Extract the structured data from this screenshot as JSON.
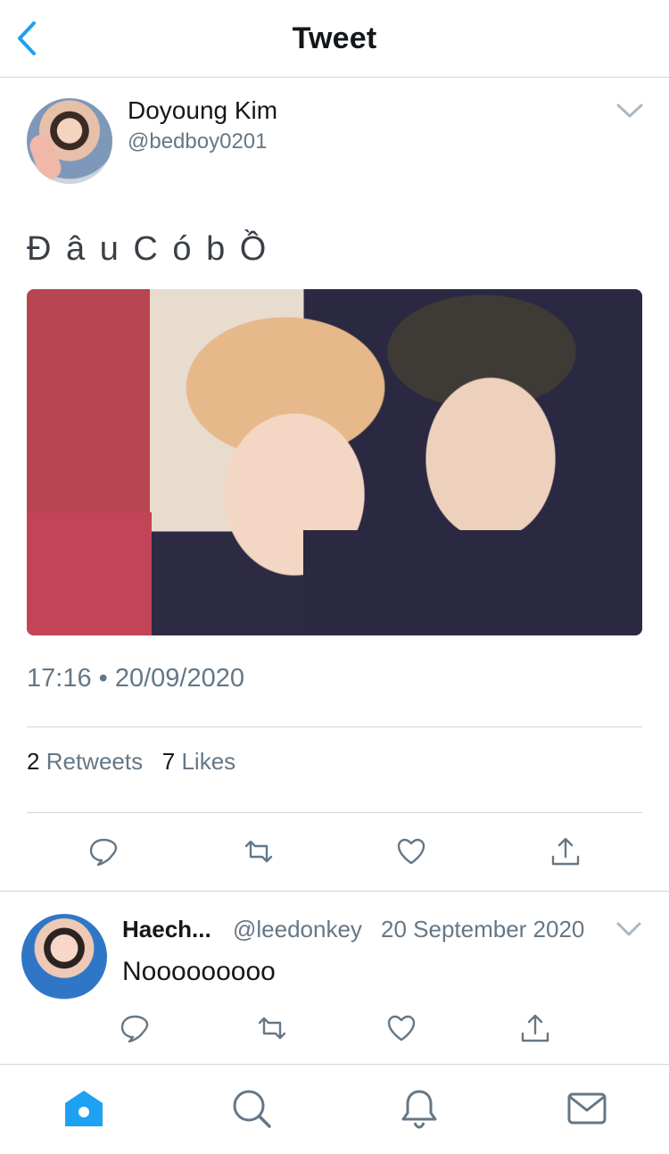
{
  "header": {
    "title": "Tweet"
  },
  "tweet": {
    "author_name": "Doyoung Kim",
    "author_handle": "@bedboy0201",
    "text": "Đ â u C ó b Ồ",
    "timestamp": "17:16 • 20/09/2020",
    "retweets_count": "2",
    "retweets_label": "Retweets",
    "likes_count": "7",
    "likes_label": "Likes"
  },
  "reply": {
    "author_name": "Haech...",
    "author_handle": "@leedonkey",
    "date": "20 September 2020",
    "text": "Nooooooooo"
  },
  "icons": {
    "back": "chevron-left-icon",
    "caret": "chevron-down-icon",
    "actions": [
      "reply-icon",
      "retweet-icon",
      "like-icon",
      "share-icon"
    ],
    "tabs": [
      "home-icon",
      "search-icon",
      "notifications-icon",
      "messages-icon"
    ]
  },
  "colors": {
    "accent": "#1da1f2",
    "muted": "#657786",
    "divider": "#ccd6dd"
  }
}
